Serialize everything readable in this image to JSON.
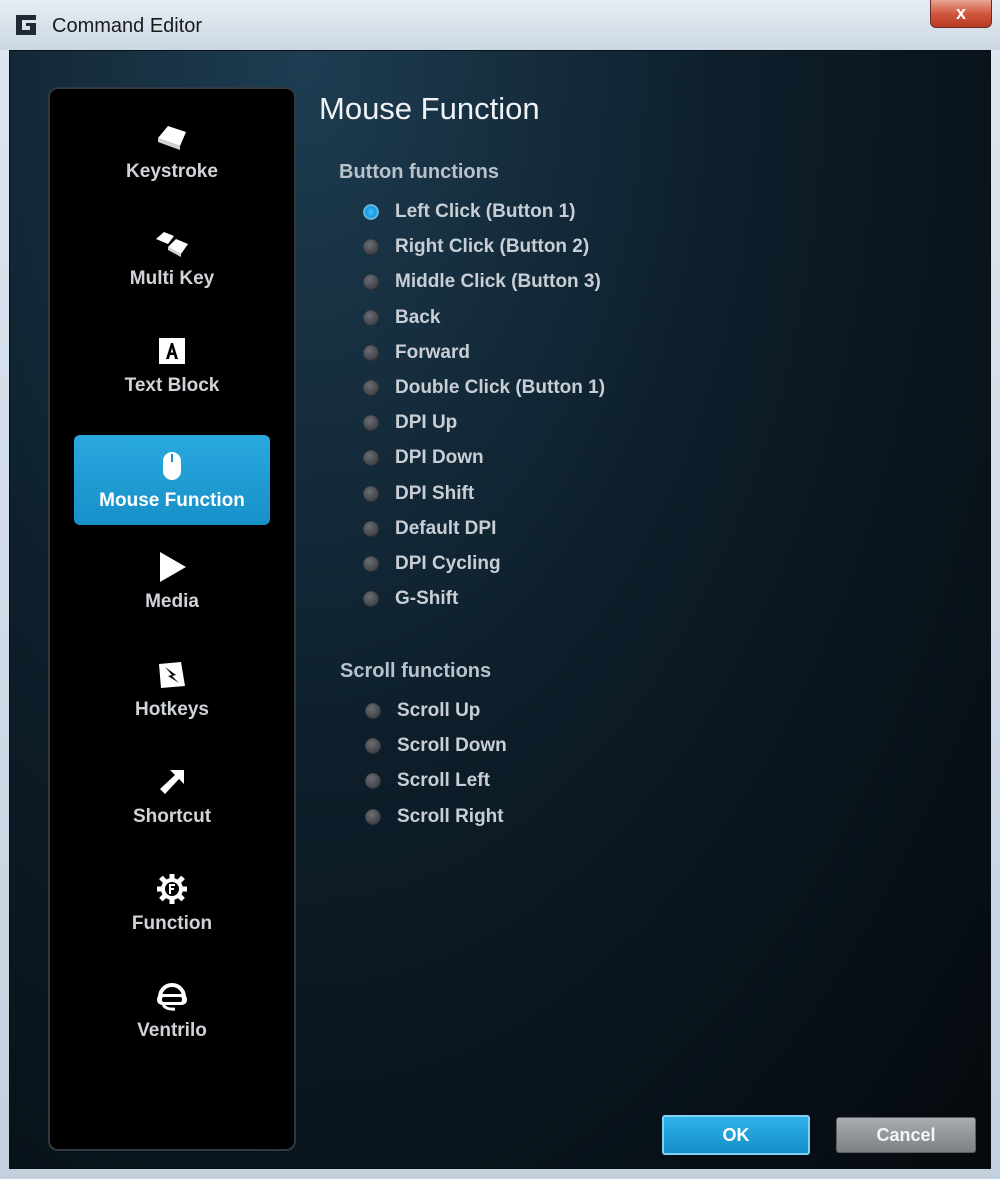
{
  "window": {
    "title": "Command Editor",
    "close_label": "x",
    "logo_icon": "logitech-g-icon"
  },
  "sidebar": {
    "items": [
      {
        "label": "Keystroke",
        "icon": "keycap-icon",
        "active": false
      },
      {
        "label": "Multi Key",
        "icon": "multi-keycap-icon",
        "active": false
      },
      {
        "label": "Text Block",
        "icon": "letter-a-icon",
        "active": false
      },
      {
        "label": "Mouse Function",
        "icon": "mouse-icon",
        "active": true
      },
      {
        "label": "Media",
        "icon": "play-icon",
        "active": false
      },
      {
        "label": "Hotkeys",
        "icon": "hotkey-icon",
        "active": false
      },
      {
        "label": "Shortcut",
        "icon": "shortcut-arrow-icon",
        "active": false
      },
      {
        "label": "Function",
        "icon": "function-gear-icon",
        "active": false
      },
      {
        "label": "Ventrilo",
        "icon": "headset-icon",
        "active": false
      }
    ]
  },
  "main": {
    "title": "Mouse Function",
    "button_functions": {
      "heading": "Button functions",
      "options": [
        {
          "label": "Left Click (Button 1)",
          "checked": true
        },
        {
          "label": "Right Click (Button 2)",
          "checked": false
        },
        {
          "label": "Middle Click (Button 3)",
          "checked": false
        },
        {
          "label": "Back",
          "checked": false
        },
        {
          "label": "Forward",
          "checked": false
        },
        {
          "label": "Double Click (Button 1)",
          "checked": false
        },
        {
          "label": "DPI Up",
          "checked": false
        },
        {
          "label": "DPI Down",
          "checked": false
        },
        {
          "label": "DPI Shift",
          "checked": false
        },
        {
          "label": "Default DPI",
          "checked": false
        },
        {
          "label": "DPI Cycling",
          "checked": false
        },
        {
          "label": "G-Shift",
          "checked": false
        }
      ]
    },
    "scroll_functions": {
      "heading": "Scroll functions",
      "options": [
        {
          "label": "Scroll Up",
          "checked": false
        },
        {
          "label": "Scroll Down",
          "checked": false
        },
        {
          "label": "Scroll Left",
          "checked": false
        },
        {
          "label": "Scroll Right",
          "checked": false
        }
      ]
    }
  },
  "footer": {
    "ok_label": "OK",
    "cancel_label": "Cancel"
  },
  "colors": {
    "accent": "#1d9ad6",
    "background": "#05090d"
  }
}
